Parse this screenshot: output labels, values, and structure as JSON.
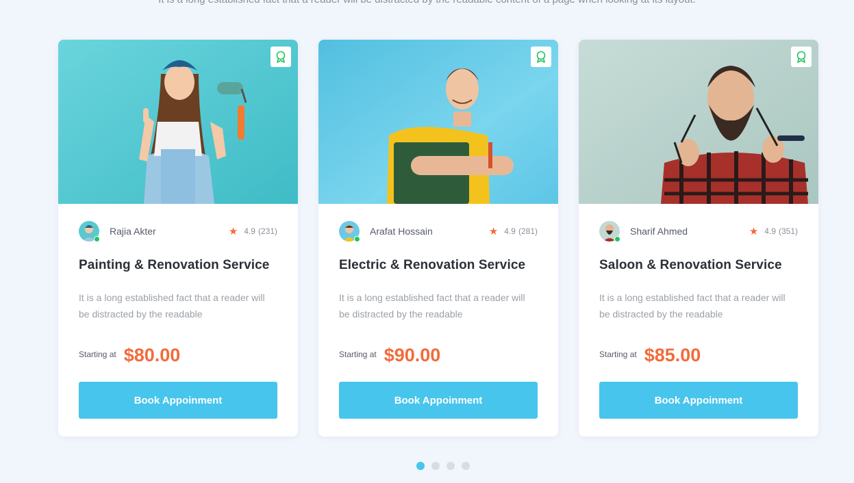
{
  "section": {
    "subtitle_fragment": "It is a long established fact that a reader will be distracted by the readable content of a page when looking at its layout."
  },
  "colors": {
    "accent": "#47c5ec",
    "price": "#f26b3a",
    "online": "#22c55e",
    "background": "#f1f5fc"
  },
  "cards": [
    {
      "provider": "Rajia Akter",
      "rating": "4.9",
      "reviews": "(231)",
      "title": "Painting & Renovation Service",
      "description": "It is a long established fact that a reader will be distracted by the readable",
      "price_label": "Starting at",
      "price": "$80.00",
      "button": "Book Appoinment",
      "bookmark_icon": "award-icon"
    },
    {
      "provider": "Arafat Hossain",
      "rating": "4.9",
      "reviews": "(281)",
      "title": "Electric & Renovation Service",
      "description": "It is a long established fact that a reader will be distracted by the readable",
      "price_label": "Starting at",
      "price": "$90.00",
      "button": "Book Appoinment",
      "bookmark_icon": "award-icon"
    },
    {
      "provider": "Sharif Ahmed",
      "rating": "4.9",
      "reviews": "(351)",
      "title": "Saloon & Renovation Service",
      "description": "It is a long established fact that a reader will be distracted by the readable",
      "price_label": "Starting at",
      "price": "$85.00",
      "button": "Book Appoinment",
      "bookmark_icon": "award-icon"
    }
  ],
  "pagination": {
    "total": 4,
    "active": 1
  }
}
